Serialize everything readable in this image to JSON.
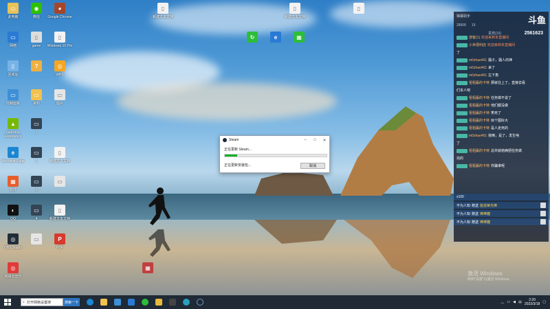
{
  "desktop": {
    "icons": [
      {
        "label": "此电脑",
        "color": "#e8c35a",
        "glyph": "▭"
      },
      {
        "label": "微信",
        "color": "#2dc100",
        "glyph": "◉"
      },
      {
        "label": "Google Chrome",
        "color": "#a4462a",
        "glyph": "●"
      },
      {
        "label": "新建文本文档",
        "color": "#f2f2f2",
        "glyph": "▯"
      },
      {
        "label": "新建文本文档",
        "color": "#f2f2f2",
        "glyph": "▯"
      },
      {
        "label": "",
        "color": "#f2f2f2",
        "glyph": "▯"
      },
      {
        "label": "网络",
        "color": "#2a7ad5",
        "glyph": "▭"
      },
      {
        "label": "game",
        "color": "#dddddd",
        "glyph": "▯"
      },
      {
        "label": "Windows 10 Pro",
        "color": "#f2f2f2",
        "glyph": "▯"
      },
      {
        "label": "回收站",
        "color": "#78b3e6",
        "glyph": "▯"
      },
      {
        "label": "",
        "color": "#f0b040",
        "glyph": "?"
      },
      {
        "label": "WPS",
        "color": "#f5a623",
        "glyph": "◎"
      },
      {
        "label": "控制面板",
        "color": "#3f8fd6",
        "glyph": "▭"
      },
      {
        "label": "资料",
        "color": "#f2c14e",
        "glyph": "▭"
      },
      {
        "label": "图片",
        "color": "#e6e6e6",
        "glyph": "▭"
      },
      {
        "label": "GeForce Experience",
        "color": "#76b900",
        "glyph": "▲"
      },
      {
        "label": "1",
        "color": "#334455",
        "glyph": "▭"
      },
      {
        "label": "Microsoft Edge",
        "color": "#1b86d1",
        "glyph": "e"
      },
      {
        "label": "2",
        "color": "#334455",
        "glyph": "▭"
      },
      {
        "label": "新建文本文档",
        "color": "#f2f2f2",
        "glyph": "▯"
      },
      {
        "label": "软件",
        "color": "#e85d2a",
        "glyph": "▦"
      },
      {
        "label": "3",
        "color": "#334455",
        "glyph": "▭"
      },
      {
        "label": "",
        "color": "#e6e6e6",
        "glyph": "▭"
      },
      {
        "label": "QQ",
        "color": "#111111",
        "glyph": "◐"
      },
      {
        "label": "4",
        "color": "#334455",
        "glyph": "▭"
      },
      {
        "label": "新建文本文档",
        "color": "#f2f2f2",
        "glyph": "▯"
      },
      {
        "label": "OBS Studio",
        "color": "#222d3a",
        "glyph": "◎"
      },
      {
        "label": "",
        "color": "#e6e6e6",
        "glyph": "▭"
      },
      {
        "label": "PDF",
        "color": "#d63a2f",
        "glyph": "P"
      },
      {
        "label": "网易云音乐",
        "color": "#e03a3a",
        "glyph": "◎"
      },
      {
        "label": "",
        "color": "#2dbd3a",
        "glyph": "↻"
      },
      {
        "label": "",
        "color": "#2a7ad5",
        "glyph": "e"
      },
      {
        "label": "",
        "color": "#2dbd3a",
        "glyph": "▦"
      },
      {
        "label": "",
        "color": "#c04040",
        "glyph": "▦"
      }
    ]
  },
  "steam_dialog": {
    "title": "Steam",
    "status_line": "正在更新 Steam...",
    "progress": 0.12,
    "status_line2": "正在更新安装包...",
    "cancel_label": "取消"
  },
  "chat": {
    "room_label": "弹幕助手",
    "logo": "斗鱼",
    "room_id": "2561623",
    "stats": [
      "28908",
      "19"
    ],
    "stats2": "贵宾(10)",
    "messages": [
      {
        "name": "游客(1)",
        "text": "欢迎来到本直播间",
        "sys": true
      },
      {
        "name": "小米便利店",
        "text": "欢迎来到本直播间",
        "sys": true
      },
      {
        "name": "",
        "text": "了",
        "sys": false
      },
      {
        "name": "m0zhao461",
        "text": "骚子，骚人的神",
        "sys": false
      },
      {
        "name": "m0zhao461",
        "text": "来了",
        "sys": false
      },
      {
        "name": "m0zhao461",
        "text": "左下角",
        "sys": false
      },
      {
        "name": "祖祖赢的卡特",
        "text": "那就往上了，直接去看",
        "sys": false
      },
      {
        "name": "",
        "text": "们本人吧",
        "sys": false
      },
      {
        "name": "祖祖赢的卡特",
        "text": "任务做不说了",
        "sys": false
      },
      {
        "name": "祖祖赢的卡特",
        "text": "他们都没做",
        "sys": false
      },
      {
        "name": "祖祖赢的卡特",
        "text": "笑死了",
        "sys": false
      },
      {
        "name": "祖祖赢的卡特",
        "text": "目个图好大",
        "sys": false
      },
      {
        "name": "祖祖赢的卡特",
        "text": "是人走死的",
        "sys": false
      },
      {
        "name": "m0zhao461",
        "text": "我倒，是了，发生啥",
        "sys": false
      },
      {
        "name": "",
        "text": "了",
        "sys": false
      },
      {
        "name": "祖祖赢的卡特",
        "text": "总共就她俩把任务做",
        "sys": false
      },
      {
        "name": "",
        "text": "完的",
        "sys": false
      },
      {
        "name": "祖祖赢的卡特",
        "text": "你骗谁呢",
        "sys": false
      }
    ],
    "gift_count": "x100",
    "gifts": [
      {
        "user": "不为人知",
        "action": "赠送",
        "gift": "能造荣光棒"
      },
      {
        "user": "不为人知",
        "action": "赠送",
        "gift": "棒棒糖"
      },
      {
        "user": "不为人知",
        "action": "赠送",
        "gift": "棒棒糖"
      }
    ]
  },
  "watermark": {
    "title": "激活 Windows",
    "sub": "转到\"设置\"以激活 Windows。"
  },
  "taskbar": {
    "search_placeholder": "打开网络设置搜",
    "search_button": "搜索一下",
    "time": "2:20",
    "date": "2022/3/18"
  }
}
